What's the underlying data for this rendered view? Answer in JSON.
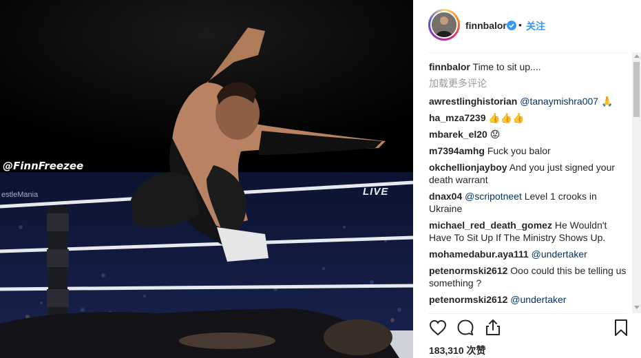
{
  "photo": {
    "watermark_handle": "@FinnFreezee",
    "watermark_event": "estleMania",
    "watermark_live": "LIVE"
  },
  "header": {
    "username": "finnbalor",
    "dot": "•",
    "follow_label": "关注"
  },
  "caption": {
    "username": "finnbalor",
    "text": "Time to sit up...."
  },
  "load_more": "加载更多评论",
  "comments": [
    {
      "username": "awrestlinghistorian",
      "mention": "@tanaymishra007",
      "text": " 🙏"
    },
    {
      "username": "ha_mza7239",
      "mention": "",
      "text": "👍👍👍"
    },
    {
      "username": "mbarek_el20",
      "mention": "",
      "text": "😟"
    },
    {
      "username": "m7394amhg",
      "mention": "",
      "text": "Fuck you balor"
    },
    {
      "username": "okchellionjayboy",
      "mention": "",
      "text": "And you just signed your death warrant"
    },
    {
      "username": "dnax04",
      "mention": "@scripotneet",
      "text": " Level 1 crooks in Ukraine"
    },
    {
      "username": "michael_red_death_gomez",
      "mention": "",
      "text": "He Wouldn't Have To Sit Up If The Ministry Shows Up."
    },
    {
      "username": "mohamedabur.aya111",
      "mention": "@undertaker",
      "text": ""
    },
    {
      "username": "petenormski2612",
      "mention": "",
      "text": "Ooo could this be telling us something ?"
    },
    {
      "username": "petenormski2612",
      "mention": "@undertaker",
      "text": ""
    }
  ],
  "actions": {
    "like_icon": "heart-icon",
    "comment_icon": "comment-icon",
    "share_icon": "share-icon",
    "save_icon": "bookmark-icon"
  },
  "likes": {
    "count": "183,310",
    "label": "次赞"
  },
  "colors": {
    "link": "#003569",
    "follow": "#3897f0",
    "verified": "#3897f0"
  }
}
